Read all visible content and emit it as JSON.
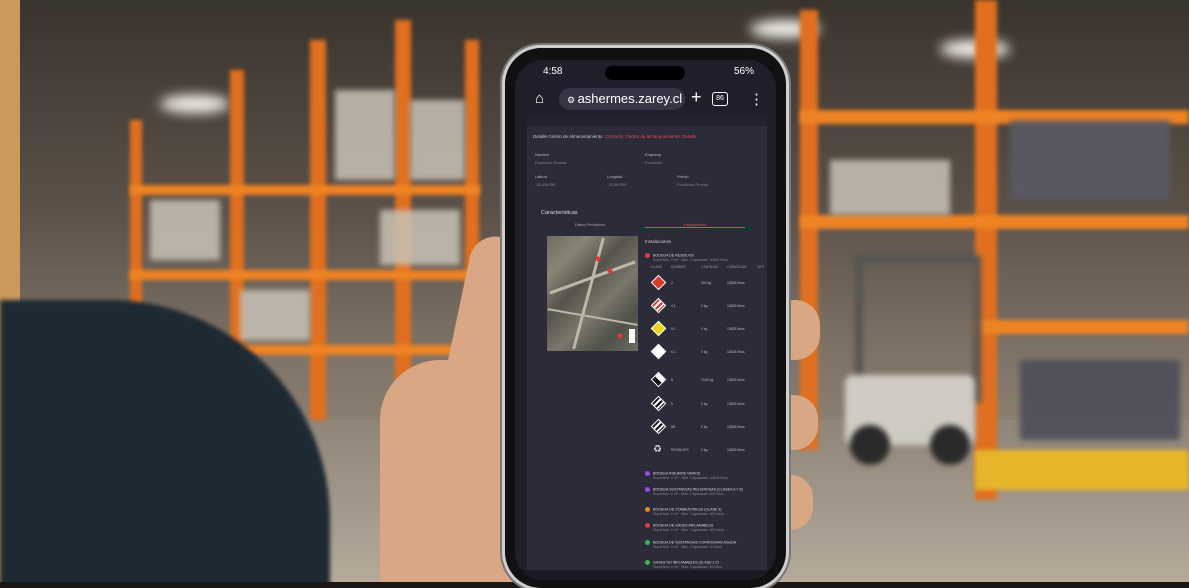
{
  "scene": {
    "description_hint": ""
  },
  "status_bar": {
    "time": "4:58",
    "signal_icon": "signal-icon",
    "battery": "56%"
  },
  "browser": {
    "home_icon": "home-icon",
    "site_settings_icon": "tune-icon",
    "url": "ashermes.zarey.cl",
    "new_tab_icon": "plus-icon",
    "tab_count": "86",
    "menu_icon": "kebab-menu-icon"
  },
  "page": {
    "breadcrumb": {
      "title": "Detalle Centro de Almacenamiento",
      "links": [
        "Contacto",
        "Centro de almacenamiento",
        "Detalle"
      ]
    },
    "fields": {
      "nombre_label": "Nombre",
      "nombre_value": "Fundición Prueba",
      "empresa_label": "Empresa",
      "empresa_value": "Fundición",
      "latitud_label": "Latitud",
      "latitud_value": "-33.456789",
      "longitud_label": "Longitud",
      "longitud_value": "-70.667891",
      "predio_label": "Predio",
      "predio_value": "Fundición Prueba"
    },
    "characteristics_title": "Características",
    "tabs": [
      "Datos Periódicos",
      "Instalaciones"
    ],
    "installations_title": "Instalaciones",
    "table_headers": [
      "CLASE",
      "NOMBRE",
      "CANTIDAD",
      "CAPACIDAD",
      "VER"
    ],
    "rows": [
      {
        "clase": "2",
        "cantidad": "300 kg",
        "capacidad": "10825 litros"
      },
      {
        "clase": "4.1",
        "cantidad": "0 kg",
        "capacidad": "10825 litros"
      },
      {
        "clase": "5.1",
        "cantidad": "0 kg",
        "capacidad": "10825 litros"
      },
      {
        "clase": "6.1",
        "cantidad": "0 kg",
        "capacidad": "10825 litros"
      },
      {
        "clase": "8",
        "cantidad": "2000 kg",
        "capacidad": "10825 litros"
      },
      {
        "clase": "9",
        "cantidad": "0 kg",
        "capacidad": "10825 litros"
      },
      {
        "clase": "9B",
        "cantidad": "0 kg",
        "capacidad": "10825 litros"
      },
      {
        "clase": "RESIDUOS",
        "cantidad": "0 kg",
        "capacidad": "10825 litros"
      }
    ],
    "warehouses": [
      {
        "name": "BODEGA DE RESIDUOS",
        "sub": "Superficie: 0 m² · Máx. Capacidad: 10825 litros",
        "color": "#e03a3a"
      },
      {
        "name": "BODEGA INSUMOS VARIOS",
        "sub": "Superficie: 0 m² · Máx. Capacidad: 10825 litros",
        "color": "#9b4fd6"
      },
      {
        "name": "BODEGA SUSTANCIAS PELIGROSAS (CLASES 6 Y 8)",
        "sub": "Superficie: 0 m² · Máx. Capacidad: 400 litros",
        "color": "#9b4fd6"
      },
      {
        "name": "BODEGA DE COMBUSTIBLES (CLASE 3)",
        "sub": "Superficie: 0 m² · Máx. Capacidad: 400 litros",
        "color": "#e88a1a"
      },
      {
        "name": "BODEGA DE GASES INFLAMABLES",
        "sub": "Superficie: 0 m² · Máx. Capacidad: 400 litros",
        "color": "#e03a3a"
      },
      {
        "name": "BODEGA DE SUSTANCIAS CORROSIVAS AGUDA",
        "sub": "Superficie: 0 m² · Máx. Capacidad: 40 litros",
        "color": "#3bb54a"
      },
      {
        "name": "GASES NO INFLAMABLES (CLASE 2.2)",
        "sub": "Superficie: 0 m² · Máx. Capacidad: 40 litros",
        "color": "#3bb54a"
      }
    ]
  }
}
